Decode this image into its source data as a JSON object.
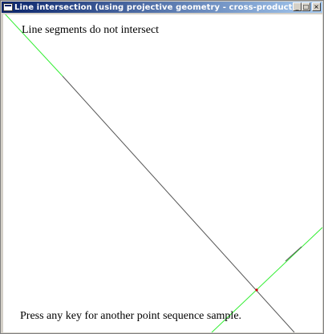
{
  "window": {
    "title": "Line intersection (using projective geometry - cross-product)",
    "app_icon": "window-icon",
    "buttons": {
      "minimize": "_",
      "maximize": "□",
      "close": "×"
    }
  },
  "canvas": {
    "status_message": "Line segments do not intersect",
    "instruction_message": "Press any key for another point sequence sample.",
    "colors": {
      "infinite_line": "#33ee33",
      "segment": "#555555",
      "intersection_point": "#cc0000",
      "background": "#ffffff"
    }
  }
}
